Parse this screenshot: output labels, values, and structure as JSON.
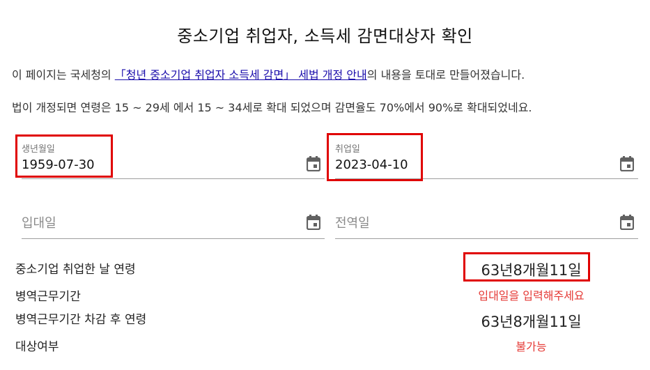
{
  "header": {
    "title": "중소기업 취업자, 소득세 감면대상자 확인"
  },
  "intro": {
    "line1_prefix": "이 페이지는 국세청의 ",
    "line1_link": "「청년 중소기업 취업자 소득세 감면」 세법 개정 안내",
    "line1_suffix": "의 내용을 토대로 만들어졌습니다.",
    "line2": "법이 개정되면 연령은 15 ~ 29세 에서 15 ~ 34세로 확대 되었으며 감면율도 70%에서 90%로 확대되었네요."
  },
  "form": {
    "birth": {
      "label": "생년월일",
      "value": "1959-07-30"
    },
    "employment": {
      "label": "취업일",
      "value": "2023-04-10"
    },
    "enlist": {
      "placeholder": "입대일"
    },
    "discharge": {
      "placeholder": "전역일"
    }
  },
  "results": [
    {
      "label": "중소기업 취업한 날 연령",
      "value": "63년8개월11일"
    },
    {
      "label": "병역근무기간",
      "value": "입대일을 입력해주세요"
    },
    {
      "label": "병역근무기간 차감 후 연령",
      "value": "63년8개월11일"
    },
    {
      "label": "대상여부",
      "value": "불가능"
    }
  ],
  "icons": {
    "calendar": "calendar-icon"
  },
  "colors": {
    "highlight": "#e00000",
    "error": "#e53935",
    "link": "#1a0dab"
  }
}
